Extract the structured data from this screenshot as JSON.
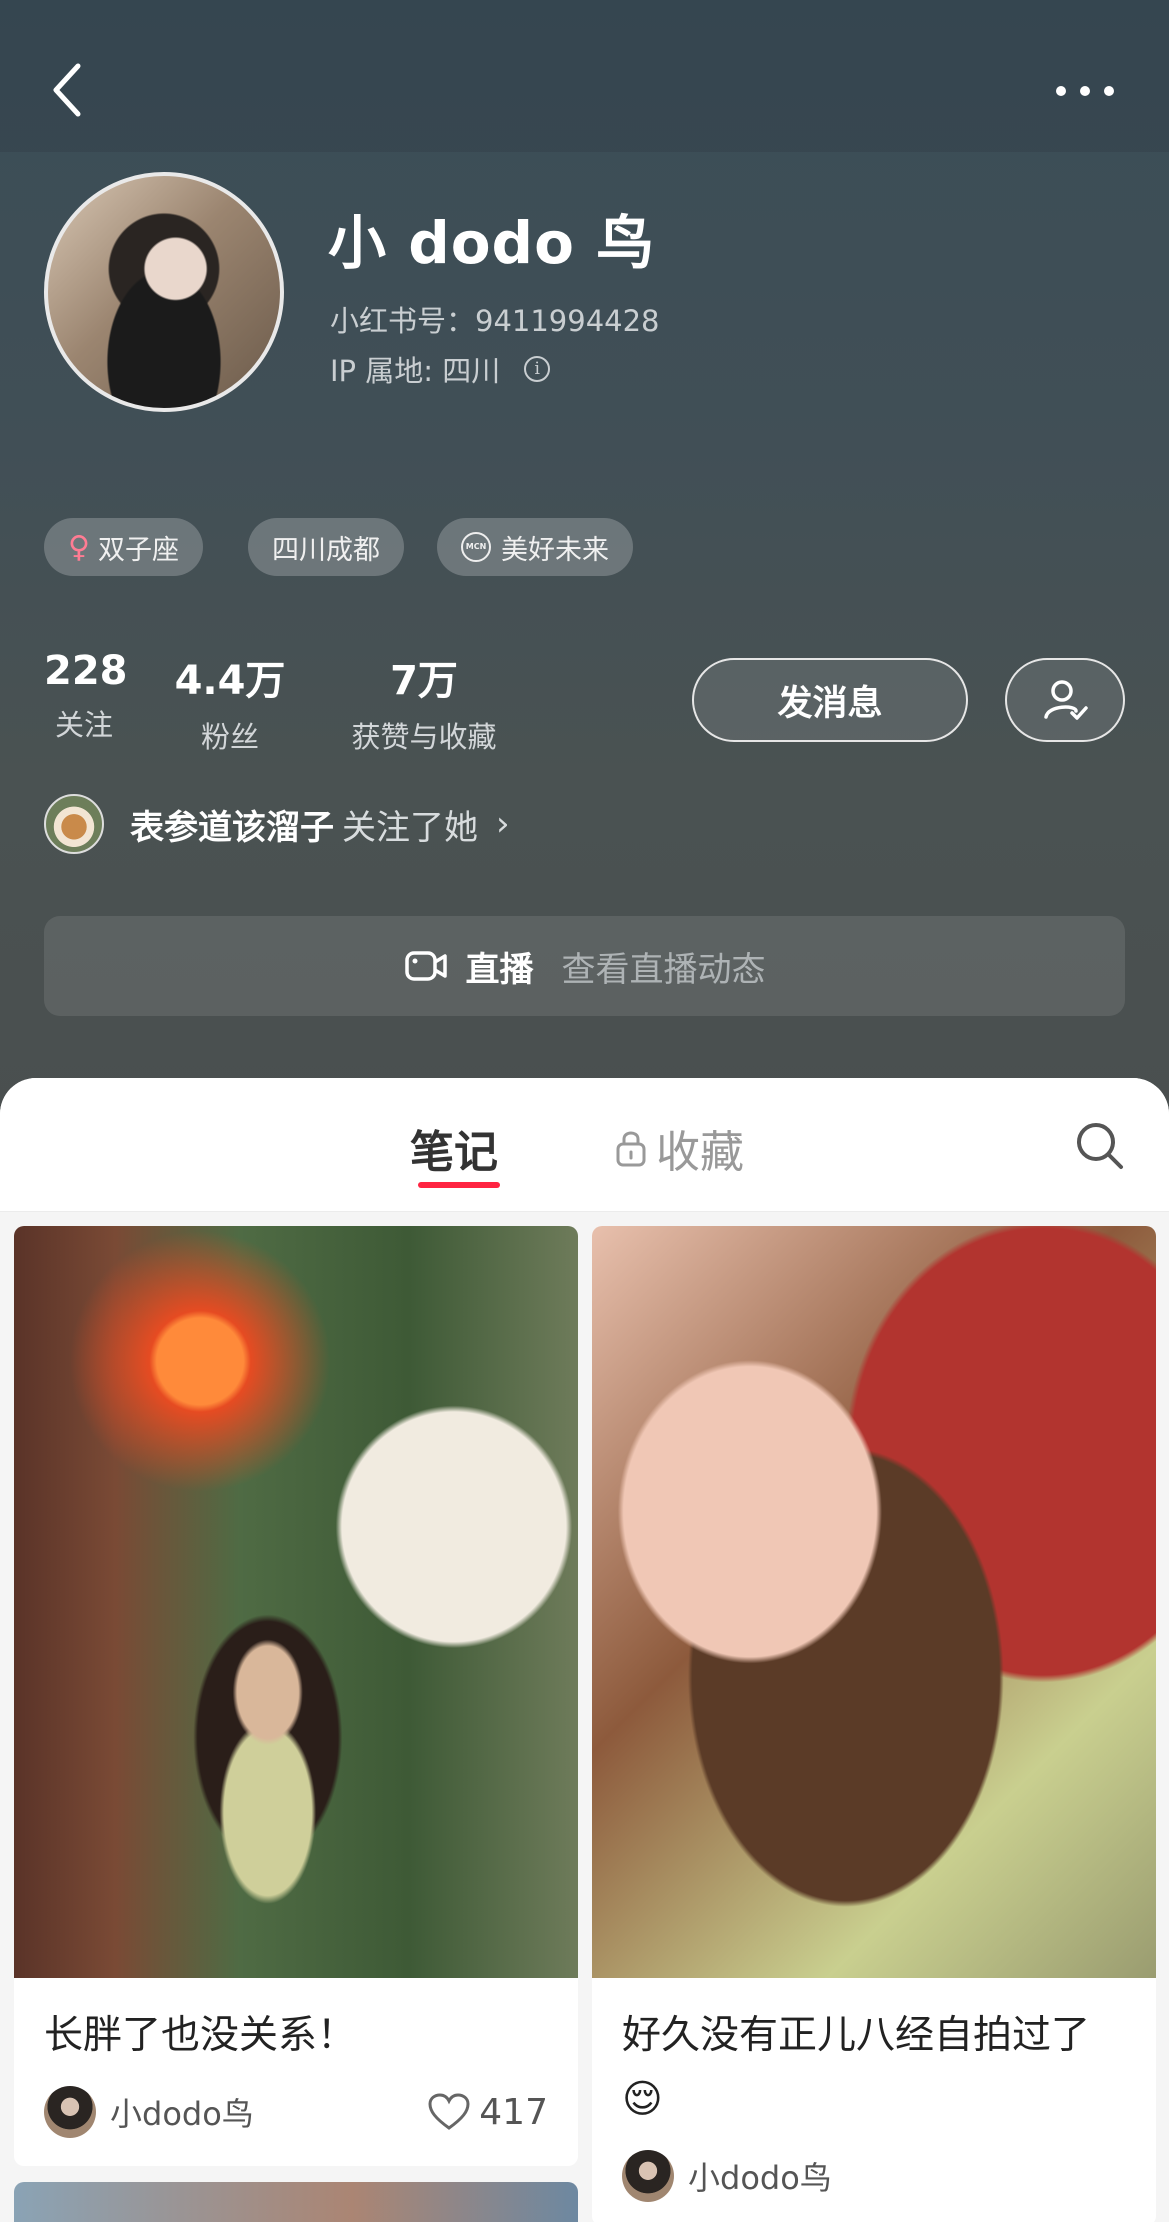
{
  "profile": {
    "name": "小 dodo 鸟",
    "red_id": "小红书号：9411994428",
    "ip_location": "IP 属地: 四川",
    "tags": [
      "双子座",
      "四川成都",
      "美好未来"
    ],
    "mcn_label": "MCN"
  },
  "stats": [
    {
      "value": "228",
      "label": "关注"
    },
    {
      "value": "4.4万",
      "label": "粉丝"
    },
    {
      "value": "7万",
      "label": "获赞与收藏"
    }
  ],
  "actions": {
    "message_label": "发消息"
  },
  "mutual": {
    "name": "表参道该溜子",
    "text": "关注了她",
    "arrow": "›"
  },
  "live": {
    "title": "直播",
    "desc": "查看直播动态"
  },
  "tabs": {
    "notes": "笔记",
    "collections": "收藏"
  },
  "notes": [
    {
      "title": "长胖了也没关系！",
      "author": "小dodo鸟",
      "likes": "417"
    },
    {
      "title": "好久没有正儿八经自拍过了😌",
      "author": "小dodo鸟"
    }
  ],
  "colors": {
    "accent": "#ff2442",
    "header_bg": "#414f56"
  }
}
